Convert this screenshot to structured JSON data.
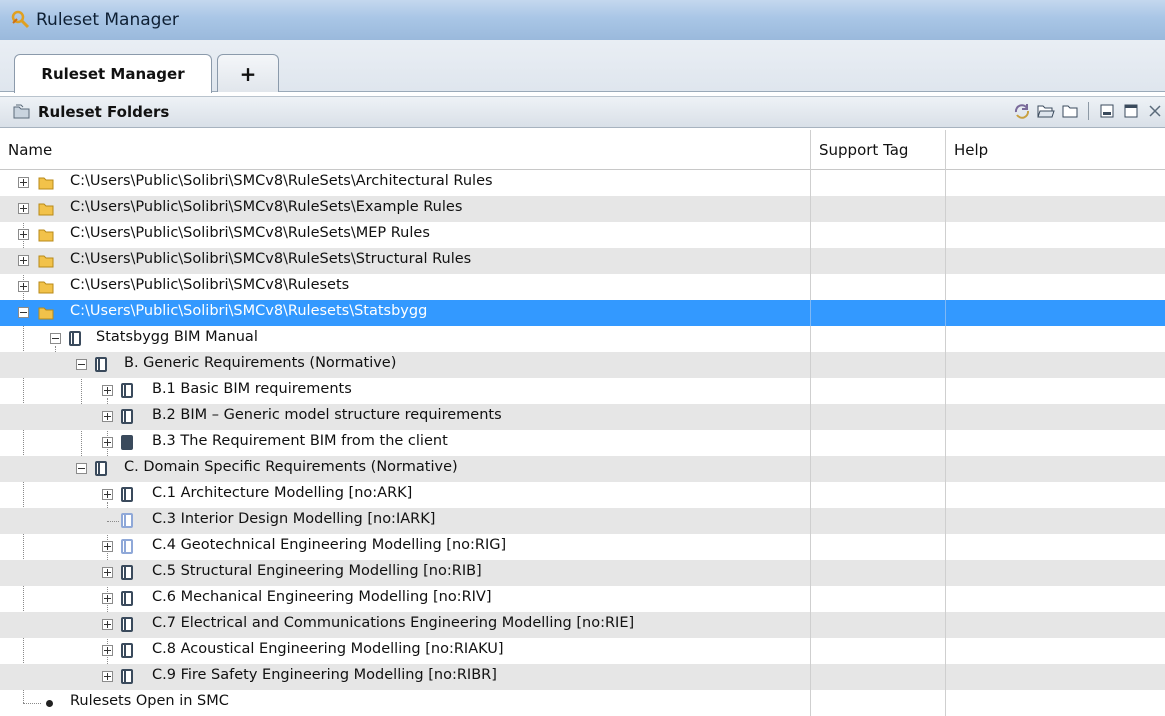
{
  "window": {
    "title": "Ruleset Manager"
  },
  "tabs": [
    {
      "label": "Ruleset Manager"
    },
    {
      "label": "+"
    }
  ],
  "panel": {
    "title": "Ruleset Folders"
  },
  "columns": {
    "name": "Name",
    "support_tag": "Support Tag",
    "help": "Help"
  },
  "tree": {
    "folders": [
      "C:\\Users\\Public\\Solibri\\SMCv8\\RuleSets\\Architectural Rules",
      "C:\\Users\\Public\\Solibri\\SMCv8\\RuleSets\\Example Rules",
      "C:\\Users\\Public\\Solibri\\SMCv8\\RuleSets\\MEP Rules",
      "C:\\Users\\Public\\Solibri\\SMCv8\\RuleSets\\Structural Rules",
      "C:\\Users\\Public\\Solibri\\SMCv8\\Rulesets",
      "C:\\Users\\Public\\Solibri\\SMCv8\\Rulesets\\Statsbygg"
    ],
    "manual": "Statsbygg BIM Manual",
    "b_section": "B. Generic Requirements (Normative)",
    "b_items": [
      "B.1 Basic BIM requirements",
      "B.2 BIM – Generic model structure requirements",
      "B.3 The Requirement BIM from the client"
    ],
    "c_section": "C. Domain Specific Requirements (Normative)",
    "c_items": [
      "C.1 Architecture Modelling [no:ARK]",
      "C.3 Interior Design Modelling [no:IARK]",
      "C.4 Geotechnical Engineering Modelling [no:RIG]",
      "C.5 Structural Engineering Modelling [no:RIB]",
      "C.6 Mechanical Engineering Modelling [no:RIV]",
      "C.7 Electrical and Communications Engineering Modelling [no:RIE]",
      "C.8 Acoustical Engineering Modelling [no:RIAKU]",
      "C.9 Fire Safety Engineering Modelling [no:RIBR]"
    ],
    "open_in_smc": "Rulesets Open in SMC"
  },
  "colors": {
    "selection": "#3399ff",
    "alt_row": "#e6e6e6",
    "folder": "#f2c24a"
  }
}
